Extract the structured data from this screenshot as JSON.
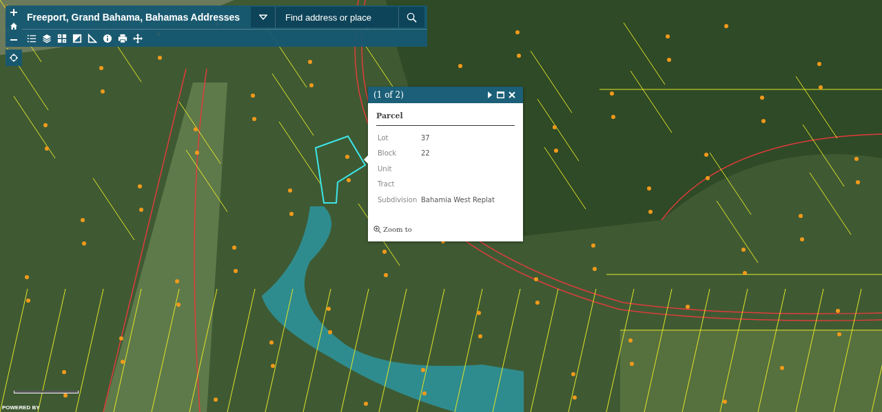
{
  "app": {
    "title": "Freeport, Grand Bahama, Bahamas Addresses"
  },
  "search": {
    "placeholder": "Find address or place"
  },
  "popup": {
    "pager": "(1 of 2)",
    "title": "Parcel",
    "fields": [
      {
        "label": "Lot",
        "value": "37"
      },
      {
        "label": "Block",
        "value": "22"
      },
      {
        "label": "Unit"
      },
      {
        "label": "Tract"
      },
      {
        "label": "Subdivision",
        "value": "Bahamia West Replat"
      }
    ],
    "zoom_link": "Zoom to"
  },
  "attribution": "POWERED BY"
}
